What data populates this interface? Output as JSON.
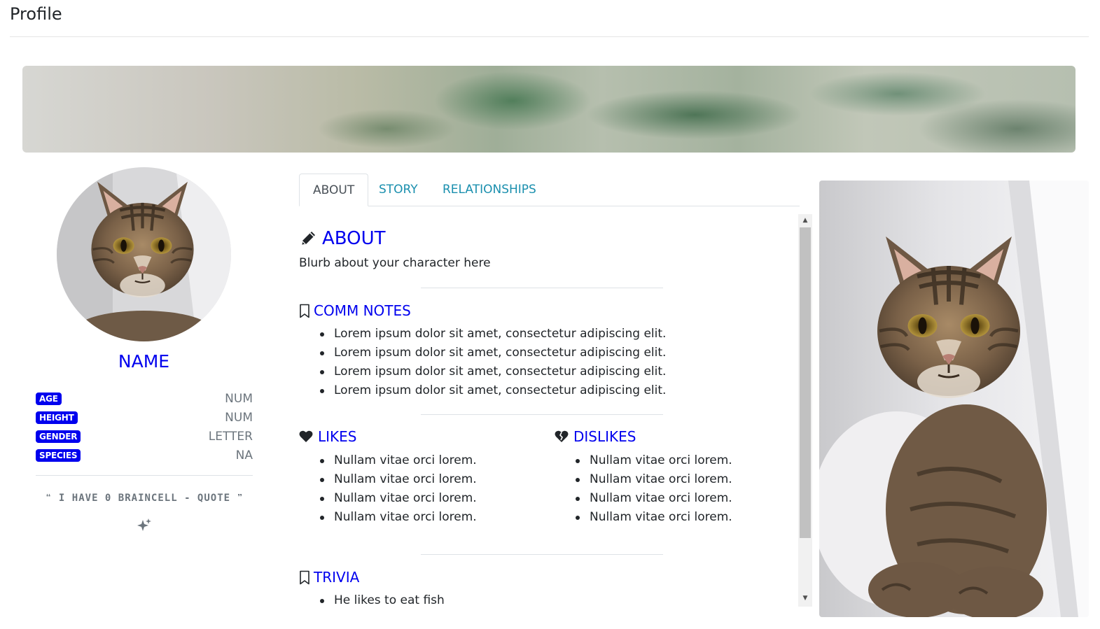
{
  "page": {
    "title": "Profile"
  },
  "character": {
    "name": "NAME",
    "stats": [
      {
        "label": "AGE",
        "value": "NUM"
      },
      {
        "label": "HEIGHT",
        "value": "NUM"
      },
      {
        "label": "GENDER",
        "value": "LETTER"
      },
      {
        "label": "SPECIES",
        "value": "NA"
      }
    ],
    "quote": "I HAVE 0 BRAINCELL - QUOTE"
  },
  "tabs": [
    {
      "label": "ABOUT",
      "active": true
    },
    {
      "label": "STORY",
      "active": false
    },
    {
      "label": "RELATIONSHIPS",
      "active": false
    }
  ],
  "about": {
    "title": "ABOUT",
    "blurb": "Blurb about your character here",
    "comm_notes": {
      "title": "COMM NOTES",
      "items": [
        "Lorem ipsum dolor sit amet, consectetur adipiscing elit.",
        "Lorem ipsum dolor sit amet, consectetur adipiscing elit.",
        "Lorem ipsum dolor sit amet, consectetur adipiscing elit.",
        "Lorem ipsum dolor sit amet, consectetur adipiscing elit."
      ]
    },
    "likes": {
      "title": "LIKES",
      "items": [
        "Nullam vitae orci lorem.",
        "Nullam vitae orci lorem.",
        "Nullam vitae orci lorem.",
        "Nullam vitae orci lorem."
      ]
    },
    "dislikes": {
      "title": "DISLIKES",
      "items": [
        "Nullam vitae orci lorem.",
        "Nullam vitae orci lorem.",
        "Nullam vitae orci lorem.",
        "Nullam vitae orci lorem."
      ]
    },
    "trivia": {
      "title": "TRIVIA",
      "items": [
        "He likes to eat fish"
      ]
    }
  },
  "colors": {
    "accent": "#0000ee",
    "tab_link": "#1a8fae",
    "muted": "#6c757d"
  },
  "icons": {
    "about": "pencil-icon",
    "comm_notes": "bookmark-icon",
    "likes": "heart-icon",
    "dislikes": "broken-heart-icon",
    "trivia": "bookmark-icon",
    "quote_open": "quote-left-icon",
    "quote_close": "quote-right-icon",
    "sparkle": "sparkles-icon"
  }
}
